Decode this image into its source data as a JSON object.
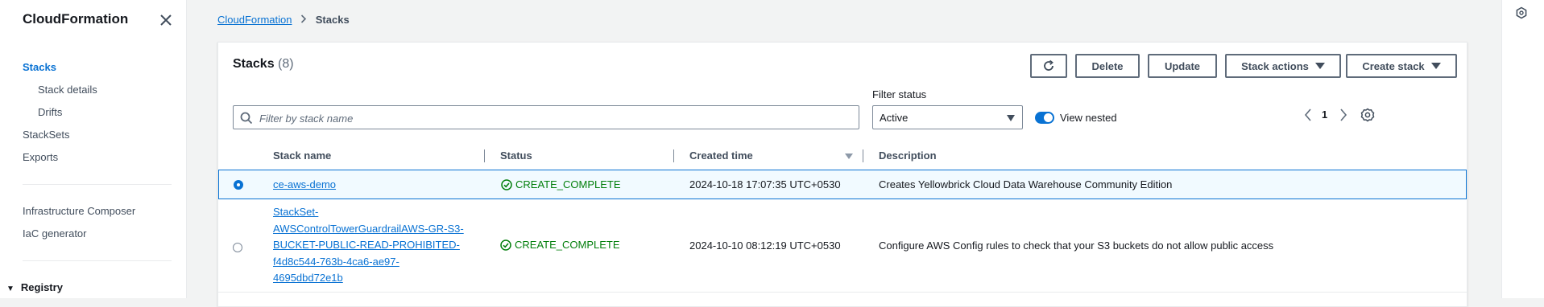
{
  "sidebar": {
    "title": "CloudFormation",
    "items": [
      {
        "label": "Stacks"
      },
      {
        "label": "Stack details"
      },
      {
        "label": "Drifts"
      },
      {
        "label": "StackSets"
      },
      {
        "label": "Exports"
      },
      {
        "label": "Infrastructure Composer"
      },
      {
        "label": "IaC generator"
      }
    ],
    "section": "Registry"
  },
  "breadcrumb": {
    "root": "CloudFormation",
    "current": "Stacks"
  },
  "panel": {
    "title": "Stacks",
    "count": "(8)",
    "buttons": {
      "delete": "Delete",
      "update": "Update",
      "stack_actions": "Stack actions",
      "create_stack": "Create stack"
    },
    "search": {
      "placeholder": "Filter by stack name",
      "value": ""
    },
    "filter": {
      "label": "Filter status",
      "selected": "Active"
    },
    "view_nested": "View nested",
    "page": "1"
  },
  "table": {
    "columns": [
      "Stack name",
      "Status",
      "Created time",
      "Description"
    ],
    "rows": [
      {
        "selected": true,
        "name": "ce-aws-demo",
        "status": "CREATE_COMPLETE",
        "created": "2024-10-18 17:07:35 UTC+0530",
        "description": "Creates Yellowbrick Cloud Data Warehouse Community Edition"
      },
      {
        "selected": false,
        "name_lines": [
          "StackSet-",
          "AWSControlTowerGuardrailAWS-GR-S3-",
          "BUCKET-PUBLIC-READ-PROHIBITED-",
          "f4d8c544-763b-4ca6-ae97-",
          "4695dbd72e1b"
        ],
        "status": "CREATE_COMPLETE",
        "created": "2024-10-10 08:12:19 UTC+0530",
        "description": "Configure AWS Config rules to check that your S3 buckets do not allow public access"
      }
    ]
  },
  "colors": {
    "accent": "#0972d3",
    "success": "#037f0c"
  }
}
